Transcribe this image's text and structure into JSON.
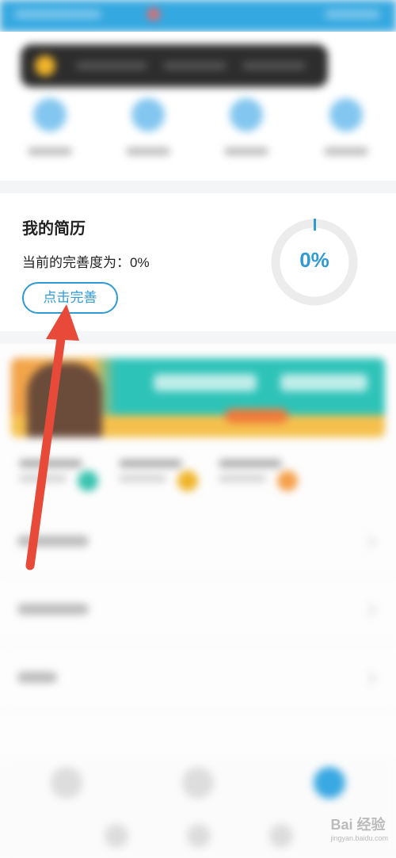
{
  "resume": {
    "title": "我的简历",
    "status_text": "当前的完善度为：0%",
    "button_label": "点击完善",
    "progress_percent": 0,
    "progress_label": "0%"
  },
  "colors": {
    "accent": "#2f9bd2",
    "topbar": "#34a8e0",
    "arrow": "#e84a3a"
  },
  "watermark": {
    "brand": "Bai 经验",
    "url": "jingyan.baidu.com"
  }
}
